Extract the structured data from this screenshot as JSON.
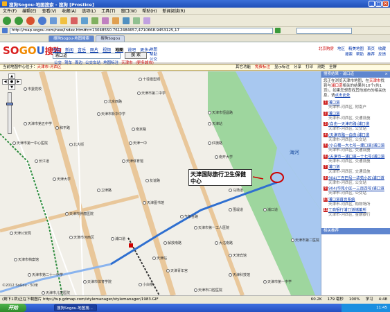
{
  "window": {
    "title": "搜狗Sogou-地图搜索 - 搜狗 [Prostice]",
    "buttons": [
      "_",
      "□",
      "×"
    ]
  },
  "menu": [
    "文件(F)",
    "编辑(E)",
    "查看(V)",
    "收藏(A)",
    "选项(L)",
    "工具(T)",
    "窗口(W)",
    "帮助(H)",
    "新闻阅读(R)"
  ],
  "address": {
    "url": "http://map.sogou.com/new/index.htm#c=13048550.7612484657,4710668.9453125,17"
  },
  "tabs": [
    "搜狗Sogou-地图搜索",
    "搜狗Sogou"
  ],
  "header": {
    "logo_part1": "SO",
    "logo_part2": "GO",
    "logo_part3": "U",
    "logo_cn": "搜狗",
    "nav": [
      "网页",
      "新闻",
      "音乐",
      "图片",
      "视频",
      "地图",
      "说吧",
      "更多»"
    ],
    "nav_current": "地图",
    "search_value": "浦口道",
    "search_button": "搜 索",
    "side_links": [
      "地图",
      "帮助",
      "公交"
    ],
    "quick_label": "公交",
    "quick_links": [
      "驾车",
      "周边",
      "公交车站",
      "地图标注",
      "天津市",
      "(更多城市)"
    ],
    "right_row1": [
      "北京购房",
      "地区",
      "精美地图",
      "首页",
      "收藏"
    ],
    "right_row2": [
      "搜索",
      "帮助",
      "推荐",
      "反馈"
    ]
  },
  "infobar": {
    "prefix": "当前地图中心位于：",
    "city": "天津市-河西区",
    "tools": [
      "其它功能",
      "免费标注",
      "显示标注",
      "分享",
      "打印",
      "测距",
      "全屏"
    ]
  },
  "map": {
    "river_label": "海河",
    "callout_text": "天津国际旅行卫生保健中心",
    "scale_text": "©2012 SoGou - 50米",
    "labels": [
      "十径模型阀",
      "市委党校",
      "天津市第二中学",
      "北京西路",
      "天津市恒昌路",
      "天津市新华中学",
      "天津市第五中学",
      "和平路",
      "南京路",
      "天津站",
      "天津市第一中心医院",
      "北大街",
      "天津一中",
      "红旗路",
      "长江道",
      "天津体育馆",
      "南开大学",
      "天津大学",
      "卫津路",
      "友谊路",
      "马场道",
      "天津图书馆",
      "天津市肿瘤医院",
      "气象台路",
      "围堤道",
      "浦口道",
      "天津公安局",
      "天津市第一工人医院",
      "浦口道",
      "解放南路",
      "大沽南路",
      "天津市河西区",
      "天津市档案馆",
      "天津站",
      "天津宾馆",
      "天津市第二十一中学",
      "天津青年宫",
      "天津科技馆",
      "天津市体育学院",
      "天津市第一中学",
      "小白楼",
      "天津市儿童医院",
      "天津市口腔医院",
      "天津市第二医院"
    ]
  },
  "panel": {
    "title": "搜索结果 - 浦口道",
    "desc_prefix": "您正在浏览天津市地图，在",
    "desc_city": "天津市",
    "desc_mid": "找到与",
    "desc_kw": "浦口道",
    "desc_suffix": "相关的结果共10个(共1页)，如果您想查找其他城市的相关信息，请",
    "desc_link": "点击此处",
    "results": [
      {
        "num": "1",
        "title": "浦口道",
        "addr": "天津市-河西区, 附南户"
      },
      {
        "num": "2",
        "title": "浦口道",
        "addr": "天津市-河西区, 交通设施"
      },
      {
        "num": "3",
        "title": "(自由一天津市路)浦口道",
        "addr": "天津市-河西区, 公交站"
      },
      {
        "num": "4",
        "title": "(天津市路一自由)浦口道",
        "addr": "天津市-河西区, 公交站"
      },
      {
        "num": "5",
        "title": "(小白楼一大七号一建口道)浦口道",
        "addr": "天津市-河西区, 交通设施"
      },
      {
        "num": "6",
        "title": "(天津市一浦口道一十七号)浦口道",
        "addr": "天津市-河西区, 交通设施"
      },
      {
        "num": "7",
        "title": "浦口道",
        "addr": "天津市-河西区, 交通设施"
      },
      {
        "num": "8",
        "title": "904(三百四号一华苑小区)浦口道",
        "addr": "天津市-河西区, 公交站"
      },
      {
        "num": "9",
        "title": "904(华苑小区一三百四号)浦口道",
        "addr": "天津市-河西区, 公交站"
      },
      {
        "num": "10",
        "title": "浦口道首页系统",
        "addr": "天津市-河西区, 购物场所"
      },
      {
        "num": "11",
        "title": "工商银行浦口道储蓄所",
        "addr": "天津市-河西区, 金融银行"
      }
    ],
    "footer": "相关推荐"
  },
  "status": {
    "left": "(剩下1项)正在下载图片 http://tup.gdmap.com/stylemanager/stylemanager/1983.GIF",
    "right": [
      "60.2K",
      "179 毫秒",
      "100%",
      "学习",
      "4:48"
    ]
  },
  "taskbar": {
    "start": "开始",
    "task": "搜狗Sogou-地图搜...",
    "clock": "11:45"
  },
  "colors": {
    "route": "#2f6fd0",
    "river": "#a8c8f0",
    "green": "#9ed69e",
    "road": "#e9c79a",
    "marker": "#cc0000"
  }
}
